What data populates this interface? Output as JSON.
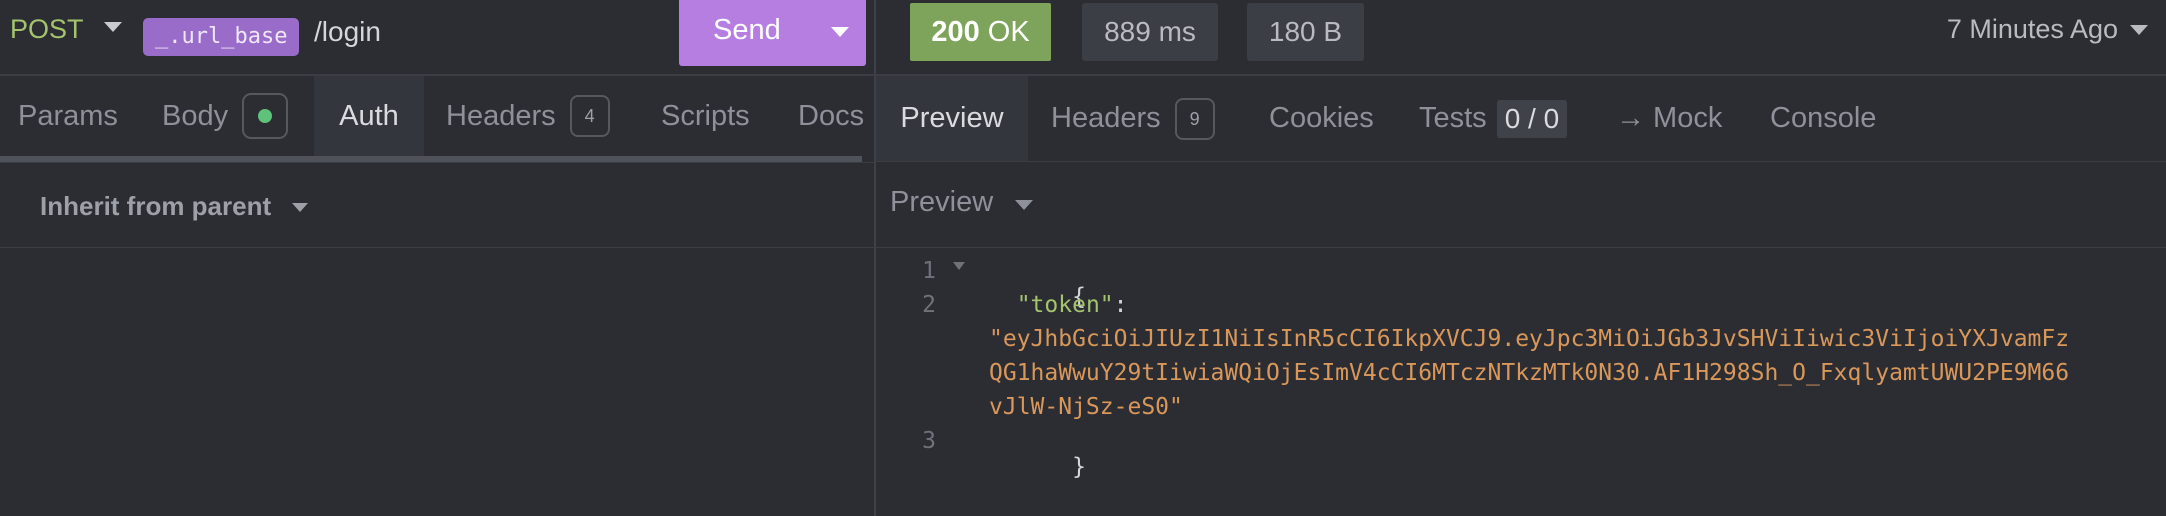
{
  "request": {
    "method": "POST",
    "url_variable": "_.url_base",
    "url_path": "/login",
    "send_label": "Send"
  },
  "request_tabs": [
    {
      "label": "Params"
    },
    {
      "label": "Body"
    },
    {
      "label": "Auth"
    },
    {
      "label": "Headers",
      "badge": "4"
    },
    {
      "label": "Scripts"
    },
    {
      "label": "Docs"
    }
  ],
  "auth": {
    "mode_label": "Inherit from parent"
  },
  "response": {
    "status_code": "200",
    "status_text": "OK",
    "time": "889 ms",
    "size": "180 B",
    "timestamp": "7 Minutes Ago"
  },
  "response_tabs": [
    {
      "label": "Preview"
    },
    {
      "label": "Headers",
      "badge": "9"
    },
    {
      "label": "Cookies"
    },
    {
      "label": "Tests",
      "count": "0 / 0"
    },
    {
      "label": "→ Mock"
    },
    {
      "label": "Console"
    }
  ],
  "preview": {
    "mode_label": "Preview",
    "line_numbers": [
      "1",
      "2",
      "3"
    ],
    "open_brace": "{",
    "key": "\"token\"",
    "colon": ":",
    "value_lines": [
      "\"eyJhbGciOiJIUzI1NiIsInR5cCI6IkpXVCJ9.eyJpc3MiOiJGb3JvSHViIiwic3ViIjoiYXJvamFz",
      "QG1haWwuY29tIiwiaWQiOjEsImV4cCI6MTczNTkzMTk0N30.AF1H298Sh_O_FxqlyamtUWU2PE9M66",
      "vJlW-NjSz-eS0\""
    ],
    "close_brace": "}"
  },
  "colors": {
    "method": "#a4c36c",
    "send_button": "#b57ee0",
    "status_ok": "#7ea35a",
    "url_variable_chip": "#9a6cc9",
    "json_key": "#a4c36c",
    "json_string": "#d9985a"
  }
}
